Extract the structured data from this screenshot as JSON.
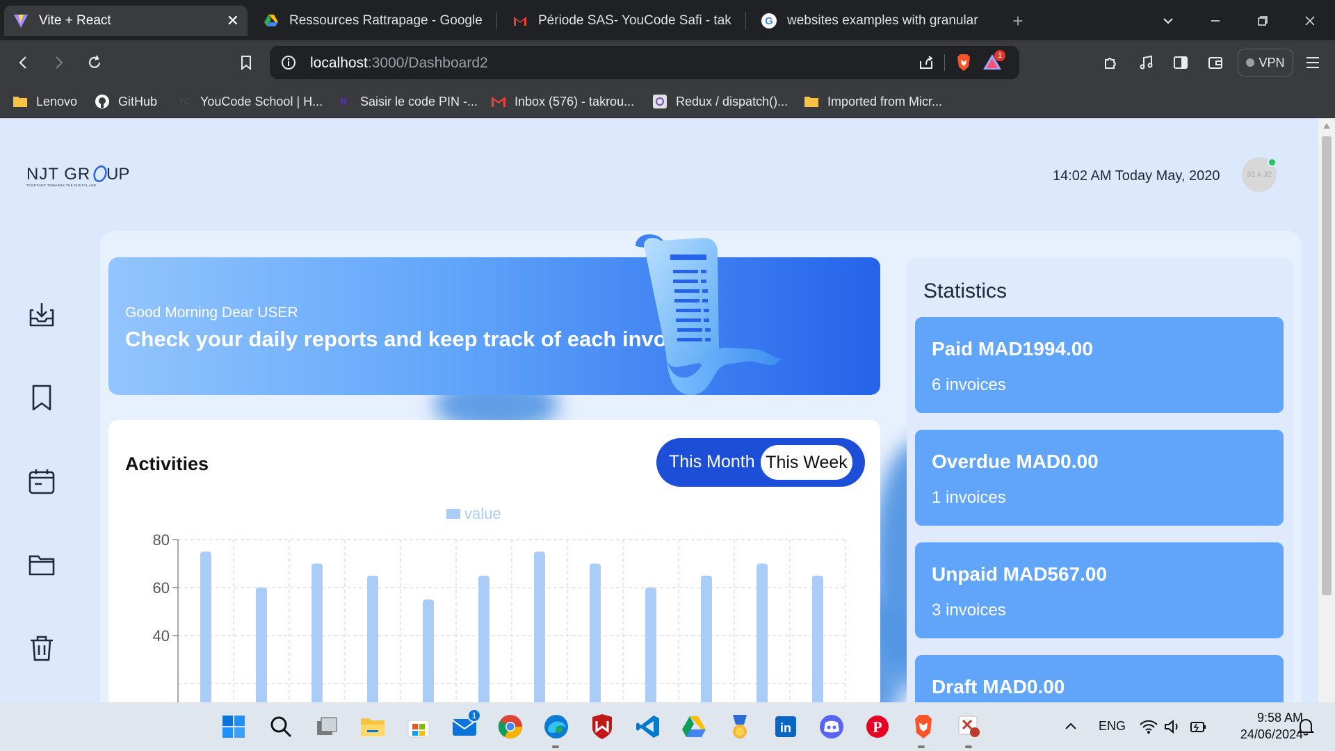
{
  "browser": {
    "tabs": [
      {
        "title": "Vite + React",
        "icon": "vite-icon",
        "active": true
      },
      {
        "title": "Ressources Rattrapage - Google Driv",
        "icon": "google-drive-icon"
      },
      {
        "title": "Période SAS- YouCode Safi - takroun",
        "icon": "gmail-icon"
      },
      {
        "title": "websites examples with granular per",
        "icon": "google-icon"
      }
    ],
    "new_tab": "+",
    "url_host": "localhost",
    "url_path": ":3000/Dashboard2",
    "vpn_label": "VPN",
    "brave_alert_count": "1",
    "bookmarks": [
      {
        "label": "Lenovo",
        "icon": "folder-icon"
      },
      {
        "label": "GitHub",
        "icon": "github-icon"
      },
      {
        "label": "YouCode School | H...",
        "icon": "youcode-icon"
      },
      {
        "label": "Saisir le code PIN -...",
        "icon": "k-icon"
      },
      {
        "label": "Inbox (576) - takrou...",
        "icon": "gmail-icon"
      },
      {
        "label": "Redux / dispatch()...",
        "icon": "redux-icon"
      },
      {
        "label": "Imported from Micr...",
        "icon": "folder-icon"
      }
    ]
  },
  "app": {
    "logo_text": "NJT GROUP",
    "logo_tagline": "TOGETHER TOWARDS THE DIGITAL AGE",
    "datetime": "14:02 AM Today May, 2020",
    "avatar_placeholder": "32 x 32",
    "sidebar": [
      "inbox-download-icon",
      "bookmark-icon",
      "calendar-icon",
      "folder-icon",
      "trash-icon"
    ],
    "banner": {
      "greeting": "Good Morning Dear USER",
      "headline": "Check your daily reports and keep track of each invoice"
    },
    "activities": {
      "title": "Activities",
      "toggle_month": "This Month",
      "toggle_week": "This Week"
    },
    "statistics": {
      "title": "Statistics",
      "cards": [
        {
          "amount": "Paid MAD1994.00",
          "count": "6 invoices"
        },
        {
          "amount": "Overdue MAD0.00",
          "count": "1 invoices"
        },
        {
          "amount": "Unpaid MAD567.00",
          "count": "3 invoices"
        },
        {
          "amount": "Draft MAD0.00",
          "count": ""
        }
      ]
    }
  },
  "chart_data": {
    "type": "bar",
    "legend": "value",
    "series": [
      {
        "name": "value",
        "values": [
          75,
          60,
          70,
          65,
          55,
          65,
          75,
          70,
          60,
          65,
          70,
          65
        ]
      }
    ],
    "y_ticks": [
      "80",
      "60",
      "40"
    ],
    "ylim": [
      0,
      80
    ],
    "grid": true,
    "bar_color": "#a9cdf7"
  },
  "taskbar": {
    "icons": [
      "windows-start-icon",
      "search-icon",
      "task-view-icon",
      "file-explorer-icon",
      "microsoft-store-icon",
      "mail-icon",
      "chrome-icon",
      "edge-icon",
      "mcafee-icon",
      "vscode-icon",
      "google-drive-icon",
      "award-icon",
      "linkedin-icon",
      "discord-icon",
      "pinterest-icon",
      "brave-icon",
      "snipping-tool-icon"
    ],
    "mail_badge": "1",
    "language": "ENG",
    "time": "9:58 AM",
    "date": "24/06/2024"
  }
}
